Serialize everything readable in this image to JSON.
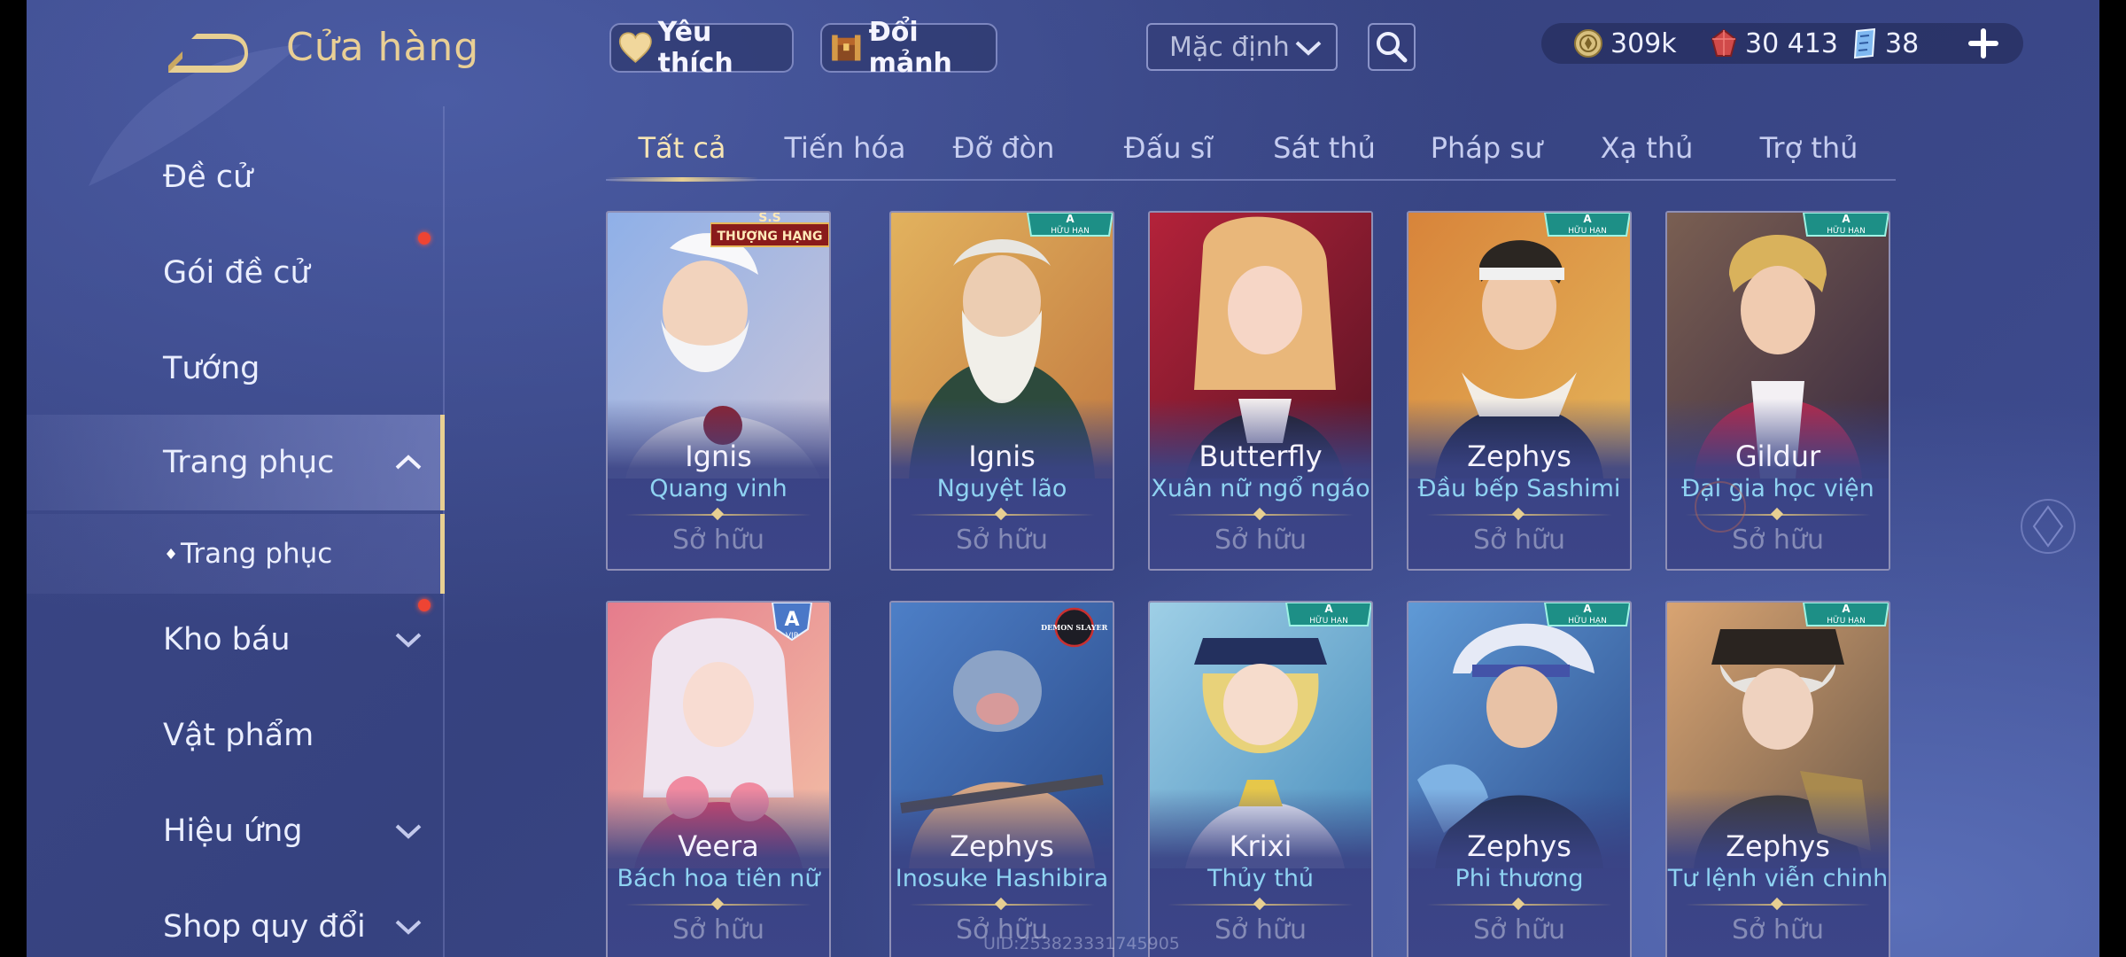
{
  "header": {
    "title": "Cửa hàng",
    "favorite_label": "Yêu thích",
    "exchange_label": "Đổi mảnh",
    "sort_value": "Mặc định"
  },
  "currency": {
    "gold": "309k",
    "vouchers": "30 413",
    "tickets": "38"
  },
  "sidebar": {
    "items": [
      {
        "label": "Đề cử"
      },
      {
        "label": "Gói đề cử"
      },
      {
        "label": "Tướng"
      },
      {
        "label": "Trang phục"
      },
      {
        "label": "Trang phục"
      },
      {
        "label": "Kho báu"
      },
      {
        "label": "Vật phẩm"
      },
      {
        "label": "Hiệu ứng"
      },
      {
        "label": "Shop quy đổi"
      }
    ]
  },
  "tabs": [
    {
      "label": "Tất cả"
    },
    {
      "label": "Tiến hóa"
    },
    {
      "label": "Đỡ đòn"
    },
    {
      "label": "Đấu sĩ"
    },
    {
      "label": "Sát thủ"
    },
    {
      "label": "Pháp sư"
    },
    {
      "label": "Xạ thủ"
    },
    {
      "label": "Trợ thủ"
    }
  ],
  "cards": [
    {
      "hero": "Ignis",
      "skin": "Quang vinh",
      "status": "Sở hữu",
      "badge": "THƯỢNG HẠNG",
      "badge_top": "S.S"
    },
    {
      "hero": "Ignis",
      "skin": "Nguyệt lão",
      "status": "Sở hữu",
      "badge": "HỮU HẠN",
      "badge_top": "A"
    },
    {
      "hero": "Butterfly",
      "skin": "Xuân nữ ngổ ngáo",
      "status": "Sở hữu"
    },
    {
      "hero": "Zephys",
      "skin": "Đầu bếp Sashimi",
      "status": "Sở hữu",
      "badge": "HỮU HẠN",
      "badge_top": "A"
    },
    {
      "hero": "Gildur",
      "skin": "Đại gia học viện",
      "status": "Sở hữu",
      "badge": "HỮU HẠN",
      "badge_top": "A"
    },
    {
      "hero": "Veera",
      "skin": "Bách hoa tiên nữ",
      "status": "Sở hữu",
      "badge": "VIP",
      "badge_top": "A"
    },
    {
      "hero": "Zephys",
      "skin": "Inosuke Hashibira",
      "status": "Sở hữu",
      "badge": "DEMON SLAYER"
    },
    {
      "hero": "Krixi",
      "skin": "Thủy thủ",
      "status": "Sở hữu",
      "badge": "HỮU HẠN",
      "badge_top": "A"
    },
    {
      "hero": "Zephys",
      "skin": "Phi thương",
      "status": "Sở hữu",
      "badge": "HỮU HẠN",
      "badge_top": "A"
    },
    {
      "hero": "Zephys",
      "skin": "Tư lệnh viễn chinh",
      "status": "Sở hữu",
      "badge": "HỮU HẠN",
      "badge_top": "A"
    }
  ],
  "watermark": "UID:253823331745905",
  "colors": {
    "accent_gold": "#e7cf92",
    "skin_name": "#8fd3f2",
    "notification": "#ee4433"
  }
}
